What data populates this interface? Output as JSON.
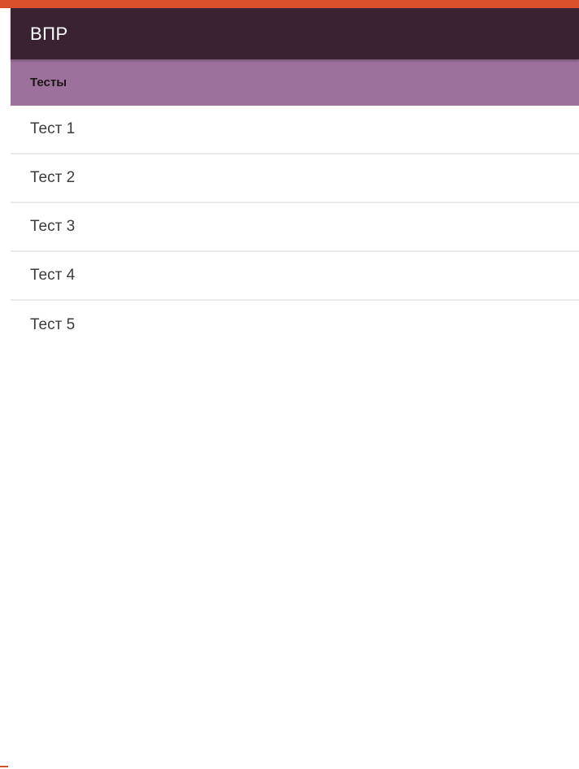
{
  "app_bar": {
    "title": "ВПР"
  },
  "section": {
    "title": "Тесты"
  },
  "tests": [
    {
      "label": "Тест 1"
    },
    {
      "label": "Тест 2"
    },
    {
      "label": "Тест 3"
    },
    {
      "label": "Тест 4"
    },
    {
      "label": "Тест 5"
    }
  ],
  "colors": {
    "accent_bar": "#d9502c",
    "app_bar_bg": "#3a2233",
    "section_header_bg": "#9c729c"
  }
}
